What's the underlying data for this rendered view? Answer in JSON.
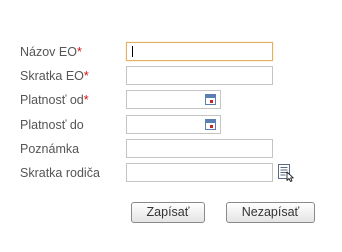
{
  "form": {
    "fields": [
      {
        "label": "Názov EO",
        "required_mark": "*",
        "value": ""
      },
      {
        "label": "Skratka EO",
        "required_mark": "*",
        "value": ""
      },
      {
        "label": "Platnosť od",
        "required_mark": "*",
        "value": ""
      },
      {
        "label": "Platnosť do",
        "required_mark": "",
        "value": ""
      },
      {
        "label": "Poznámka",
        "required_mark": "",
        "value": ""
      },
      {
        "label": "Skratka rodiča",
        "required_mark": "",
        "value": ""
      }
    ]
  },
  "icons": {
    "date_picker": "calendar-icon",
    "lookup": "lookup-list-icon"
  },
  "buttons": {
    "save_label": "Zapísať",
    "cancel_label": "Nezapísať"
  },
  "colors": {
    "required_mark": "#d01010",
    "focused_border": "#e3b060",
    "calendar_icon": "#5a7fb5"
  }
}
